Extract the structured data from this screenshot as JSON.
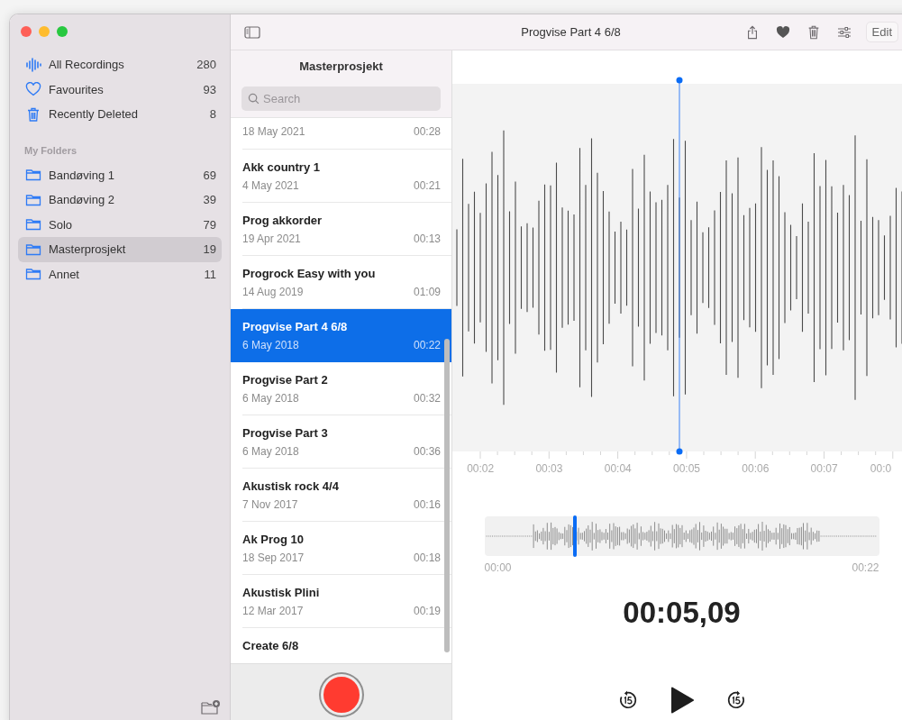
{
  "window": {
    "title": "Progvise Part 4 6/8"
  },
  "toolbar": {
    "edit_button": "Edit"
  },
  "sidebar": {
    "library": [
      {
        "kind": "waveform",
        "label": "All Recordings",
        "count": "280",
        "selected": false
      },
      {
        "kind": "heart",
        "label": "Favourites",
        "count": "93",
        "selected": false
      },
      {
        "kind": "trash",
        "label": "Recently Deleted",
        "count": "8",
        "selected": false
      }
    ],
    "section_header": "My Folders",
    "folders": [
      {
        "label": "Bandøving 1",
        "count": "69",
        "selected": false
      },
      {
        "label": "Bandøving 2",
        "count": "39",
        "selected": false
      },
      {
        "label": "Solo",
        "count": "79",
        "selected": false
      },
      {
        "label": "Masterprosjekt",
        "count": "19",
        "selected": true
      },
      {
        "label": "Annet",
        "count": "11",
        "selected": false
      }
    ]
  },
  "list": {
    "title": "Masterprosjekt",
    "search": {
      "placeholder": "Search"
    },
    "rows": [
      {
        "date": "18 May 2021",
        "duration": "00:28",
        "selected": false
      },
      {
        "title": "Akk country 1",
        "date": "4 May 2021",
        "duration": "00:21",
        "selected": false
      },
      {
        "title": "Prog akkorder",
        "date": "19 Apr 2021",
        "duration": "00:13",
        "selected": false
      },
      {
        "title": "Progrock Easy with you",
        "date": "14 Aug 2019",
        "duration": "01:09",
        "selected": false
      },
      {
        "title": "Progvise Part 4 6/8",
        "date": "6 May 2018",
        "duration": "00:22",
        "selected": true
      },
      {
        "title": "Progvise Part 2",
        "date": "6 May 2018",
        "duration": "00:32",
        "selected": false
      },
      {
        "title": "Progvise Part 3",
        "date": "6 May 2018",
        "duration": "00:36",
        "selected": false
      },
      {
        "title": "Akustisk rock 4/4",
        "date": "7 Nov 2017",
        "duration": "00:16",
        "selected": false
      },
      {
        "title": "Ak Prog 10",
        "date": "18 Sep 2017",
        "duration": "00:18",
        "selected": false
      },
      {
        "title": "Akustisk Plini",
        "date": "12 Mar 2017",
        "duration": "00:19",
        "selected": false
      },
      {
        "title": "Create 6/8",
        "selected": false
      }
    ]
  },
  "detail": {
    "timeline": {
      "ticks": [
        "00:02",
        "00:03",
        "00:04",
        "00:05",
        "00:06",
        "00:07",
        "00:0"
      ]
    },
    "overview": {
      "level": 0.23,
      "start": "00:00",
      "end": "00:22"
    },
    "time": "00:05,09"
  }
}
